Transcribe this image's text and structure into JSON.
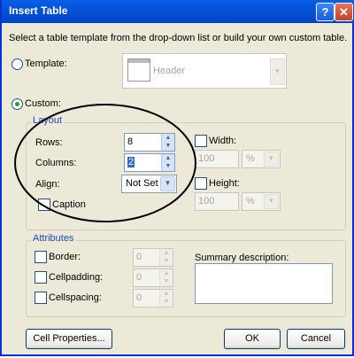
{
  "title": "Insert Table",
  "title_buttons": {
    "help": "?",
    "close": "✕"
  },
  "intro": "Select a table template from the drop-down list or build your own custom table.",
  "template": {
    "label": "Template:",
    "preview_label": "Header",
    "selected": false
  },
  "custom": {
    "label": "Custom:",
    "selected": true
  },
  "layout": {
    "legend": "Layout",
    "rows_label": "Rows:",
    "rows_value": "8",
    "columns_label": "Columns:",
    "columns_value": "2",
    "align_label": "Align:",
    "align_value": "Not Set",
    "caption_label": "Caption",
    "caption_checked": false,
    "width_label": "Width:",
    "width_value": "100",
    "width_unit": "%",
    "width_checked": false,
    "height_label": "Height:",
    "height_value": "100",
    "height_unit": "%",
    "height_checked": false
  },
  "attributes": {
    "legend": "Attributes",
    "border_label": "Border:",
    "border_value": "0",
    "cellpadding_label": "Cellpadding:",
    "cellpadding_value": "0",
    "cellspacing_label": "Cellspacing:",
    "cellspacing_value": "0",
    "summary_label": "Summary description:"
  },
  "buttons": {
    "cell_properties": "Cell Properties...",
    "ok": "OK",
    "cancel": "Cancel"
  },
  "colors": {
    "title_bar": "#0453d8",
    "group_label": "#1c48b8",
    "annotation_ellipse": "#000000"
  },
  "icons": {
    "spin": "spinner-arrows-icon",
    "dropdown": "chevron-down-icon"
  }
}
